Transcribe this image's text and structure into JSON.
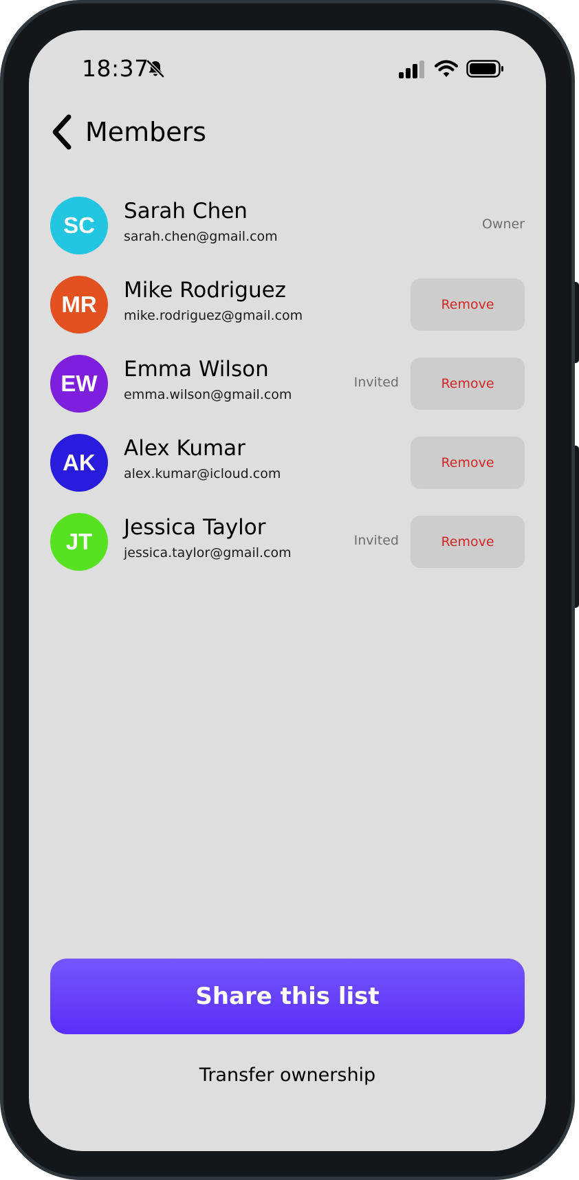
{
  "status_bar": {
    "time": "18:37",
    "icons": [
      "bell-off-icon",
      "signal-icon",
      "wifi-icon",
      "battery-icon"
    ]
  },
  "header": {
    "title": "Members",
    "back_icon": "chevron-left-icon"
  },
  "members": [
    {
      "initials": "SC",
      "name": "Sarah Chen",
      "email": "sarah.chen@gmail.com",
      "role": "Owner",
      "status": "",
      "action": "",
      "color": "#22c6e0"
    },
    {
      "initials": "MR",
      "name": "Mike Rodriguez",
      "email": "mike.rodriguez@gmail.com",
      "role": "",
      "status": "",
      "action": "Remove",
      "color": "#e2511f"
    },
    {
      "initials": "EW",
      "name": "Emma Wilson",
      "email": "emma.wilson@gmail.com",
      "role": "",
      "status": "Invited",
      "action": "Remove",
      "color": "#7d1fdc"
    },
    {
      "initials": "AK",
      "name": "Alex Kumar",
      "email": "alex.kumar@icloud.com",
      "role": "",
      "status": "",
      "action": "Remove",
      "color": "#2a1cdc"
    },
    {
      "initials": "JT",
      "name": "Jessica Taylor",
      "email": "jessica.taylor@gmail.com",
      "role": "",
      "status": "Invited",
      "action": "Remove",
      "color": "#56e121"
    }
  ],
  "actions": {
    "share_label": "Share this list",
    "transfer_label": "Transfer ownership"
  },
  "colors": {
    "accent": "#6a44fa",
    "danger": "#d42525",
    "background": "#dedede"
  }
}
